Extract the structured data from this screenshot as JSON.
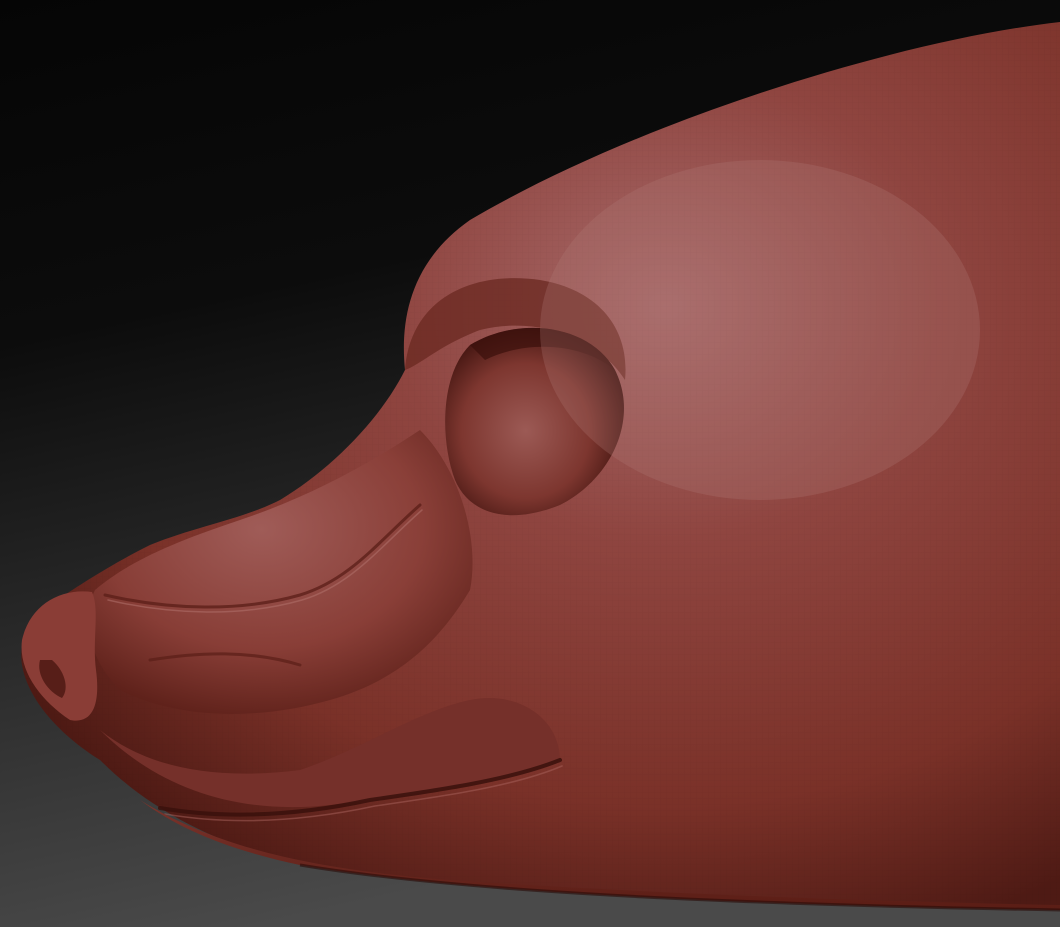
{
  "scene": {
    "subject": "sculpt-head",
    "colors": {
      "background_top": "#050505",
      "background_bottom": "#4a4a4a",
      "clay_highlight": "#a86a6a",
      "clay_mid": "#8f4540",
      "clay_base": "#7a3128",
      "clay_shadow": "#4e1a14",
      "clay_deep": "#3a100c"
    }
  }
}
